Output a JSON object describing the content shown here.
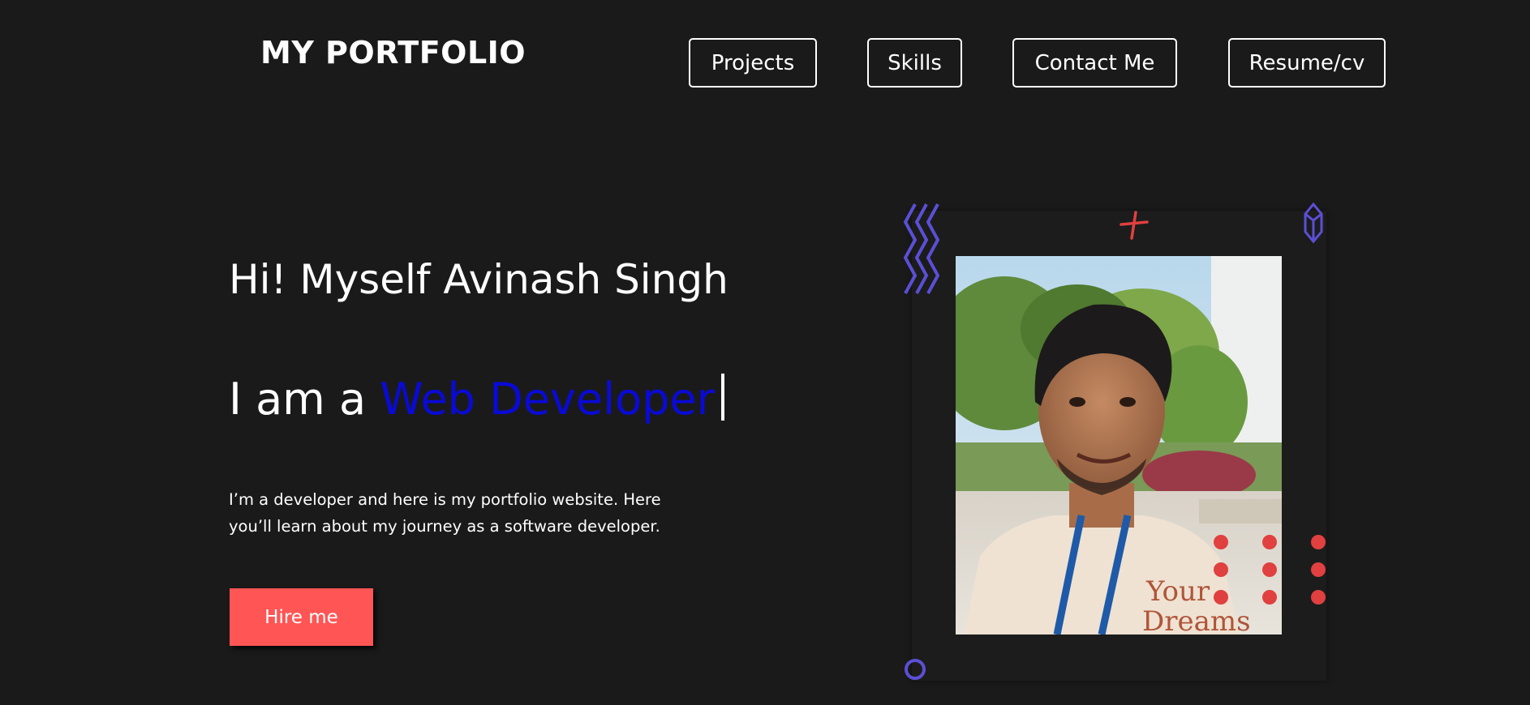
{
  "header": {
    "logo": "MY PORTFOLIO",
    "nav": {
      "projects": "Projects",
      "skills": "Skills",
      "contact": "Contact Me",
      "resume": "Resume/cv"
    }
  },
  "hero": {
    "greeting": "Hi! Myself Avinash Singh",
    "role_prefix": "I am a ",
    "role_highlight": "Web Developer",
    "intro_line1": "I’m a developer and here is my portfolio website. Here",
    "intro_line2": "you’ll learn about my journey as a software developer.",
    "hire_label": "Hire me"
  },
  "colors": {
    "background": "#1a1a1a",
    "accent_red": "#ff5555",
    "accent_blue": "#0a0ad6",
    "decor_purple": "#5b4fd6",
    "decor_red": "#e0403f"
  },
  "icons": {
    "zigzag": "zigzag-decoration-icon",
    "plus": "plus-decoration-icon",
    "gem": "gem-decoration-icon",
    "dots": "dot-grid-decoration-icon",
    "circle": "circle-decoration-icon"
  }
}
